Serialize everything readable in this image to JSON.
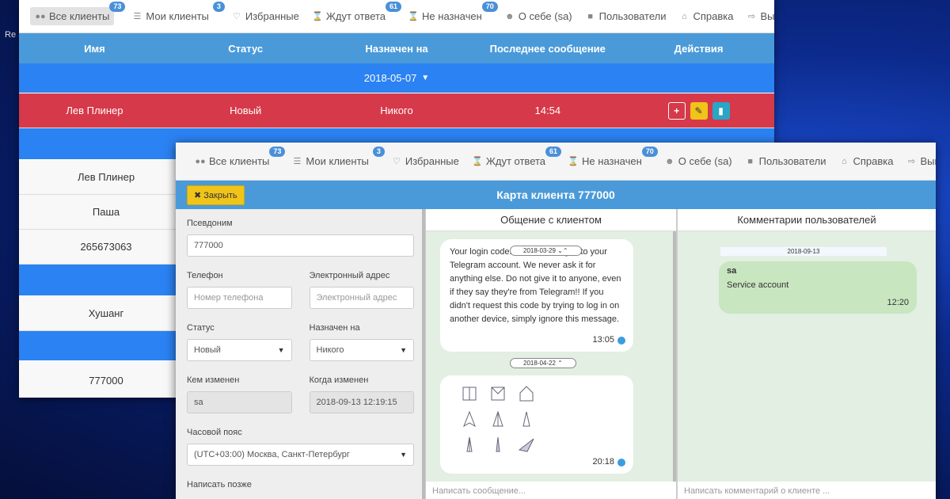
{
  "desktop": {
    "label": "Re"
  },
  "nav": {
    "items": [
      {
        "label": "Все клиенты",
        "badge": "73",
        "icon": "users-icon"
      },
      {
        "label": "Мои клиенты",
        "badge": "3",
        "icon": "list-icon"
      },
      {
        "label": "Избранные",
        "badge": "",
        "icon": "heart-icon"
      },
      {
        "label": "Ждут ответа",
        "badge": "61",
        "icon": "hourglass-icon"
      },
      {
        "label": "Не назначен",
        "badge": "70",
        "icon": "hourglass-icon"
      },
      {
        "label": "О себе (sa)",
        "badge": "",
        "icon": "user-icon"
      },
      {
        "label": "Пользователи",
        "badge": "",
        "icon": "lock-icon"
      }
    ],
    "help": "Справка",
    "logout": "Выйти"
  },
  "table": {
    "headers": [
      "Имя",
      "Статус",
      "Назначен на",
      "Последнее сообщение",
      "Действия"
    ],
    "group_date": "2018-05-07",
    "highlight_row": {
      "name": "Лев Плинер",
      "status": "Новый",
      "assigned": "Никого",
      "last": "14:54"
    },
    "rows": [
      {
        "name": "Лев Плинер"
      },
      {
        "name": "Паша"
      },
      {
        "name": "265673063"
      },
      {
        "name": ""
      },
      {
        "name": "Хушанг"
      },
      {
        "name": ""
      },
      {
        "name": "777000"
      }
    ]
  },
  "card": {
    "close_label": "Закрыть",
    "title": "Карта клиента 777000",
    "form": {
      "alias_label": "Псевдоним",
      "alias_value": "777000",
      "phone_label": "Телефон",
      "phone_placeholder": "Номер телефона",
      "email_label": "Электронный адрес",
      "email_placeholder": "Электронный адрес",
      "status_label": "Статус",
      "status_value": "Новый",
      "assigned_label": "Назначен на",
      "assigned_value": "Никого",
      "changed_by_label": "Кем изменен",
      "changed_by_value": "sa",
      "changed_at_label": "Когда изменен",
      "changed_at_value": "2018-09-13 12:19:15",
      "tz_label": "Часовой пояс",
      "tz_value": "(UTC+03:00) Москва, Санкт-Петербург",
      "write_later_label": "Написать позже"
    },
    "chat": {
      "title": "Общение с клиентом",
      "message_text": "Your login code: be used to log in to your Telegram account. We never ask it for anything else. Do not give it to anyone, even if they say they're from Telegram!! If you didn't request this code by trying to log in on another device, simply ignore this message.",
      "message_date": "2018-03-29",
      "message_time": "13:05",
      "date2": "2018-04-22",
      "image_time": "20:18",
      "input_placeholder": "Написать сообщение..."
    },
    "comments": {
      "title": "Комментарии пользователей",
      "date": "2018-09-13",
      "author": "sa",
      "text": "Service account",
      "time": "12:20",
      "input_placeholder": "Написать комментарий о клиенте ..."
    }
  },
  "colors": {
    "primary": "#4a9ad9",
    "group": "#2b82f2",
    "danger": "#d6394a",
    "warning": "#f0c419",
    "chat_bg": "#e2efe2"
  }
}
